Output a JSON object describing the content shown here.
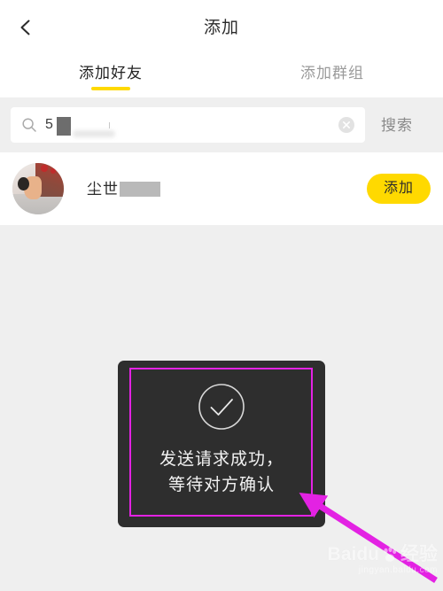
{
  "header": {
    "title": "添加",
    "back_icon": "chevron-left-icon"
  },
  "tabs": [
    {
      "label": "添加好友",
      "active": true
    },
    {
      "label": "添加群组",
      "active": false
    }
  ],
  "search": {
    "icon": "search-icon",
    "value": "5",
    "redacted": true,
    "clear_icon": "clear-circle-icon",
    "action_label": "搜索"
  },
  "results": [
    {
      "avatar": "user-avatar-photo",
      "name": "尘世",
      "name_redacted": true,
      "action_label": "添加"
    }
  ],
  "toast": {
    "icon": "check-circle-icon",
    "line1": "发送请求成功，",
    "line2": "等待对方确认"
  },
  "annotations": {
    "highlight_color": "#e322e3",
    "arrow_color": "#e322e3"
  },
  "watermark": {
    "brand": "Baidu",
    "paw_icon": "paw-icon",
    "suffix": "经验",
    "url": "jingyan.baidu.com"
  },
  "colors": {
    "accent_yellow": "#ffd900",
    "page_background": "#efefef",
    "card_background": "#ffffff",
    "toast_background": "#2e2e2e",
    "annotation_magenta": "#e322e3"
  }
}
